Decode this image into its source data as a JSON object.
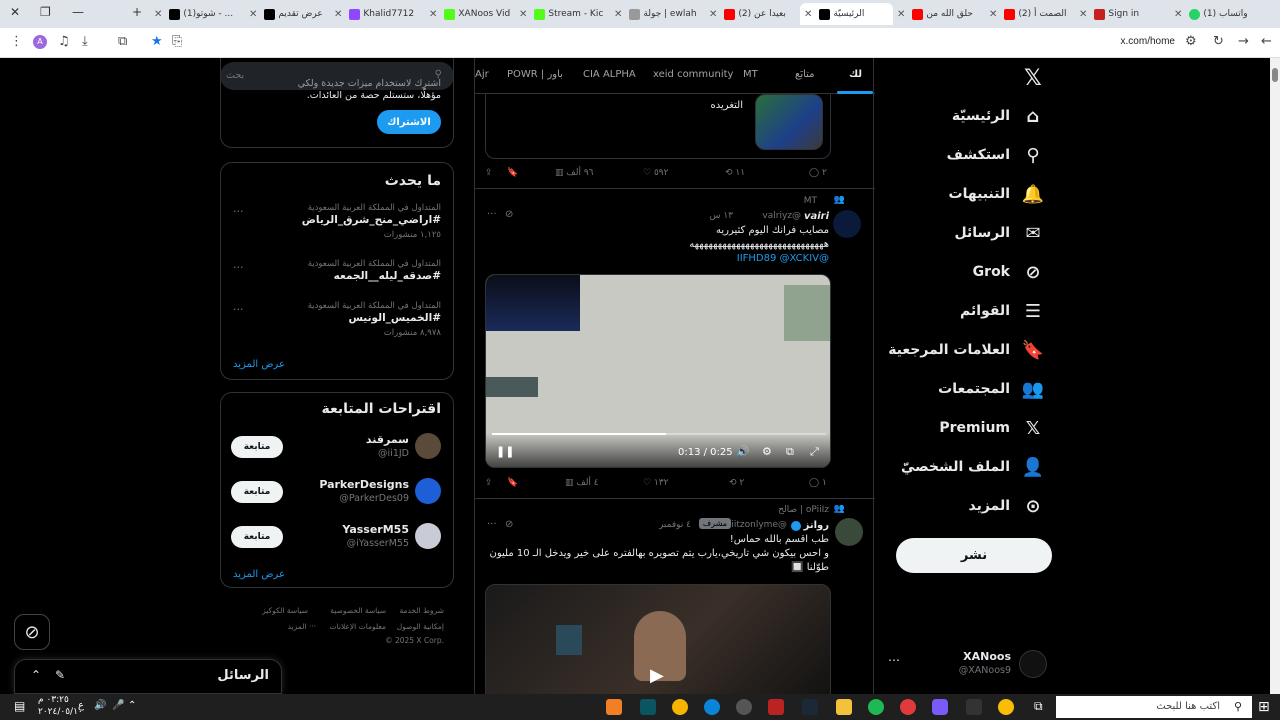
{
  "browser": {
    "tabs": [
      {
        "label": "(1) واتساب",
        "color": "#25d366"
      },
      {
        "label": "Sign in",
        "color": "#c5221f"
      },
      {
        "label": "(2) الصمت أ",
        "color": "#ff0000"
      },
      {
        "label": "حلق الله من",
        "color": "#ff0000"
      },
      {
        "label": "الرئيسيّة",
        "color": "#000000"
      },
      {
        "label": "(2) بعيدا عن",
        "color": "#ff0000"
      },
      {
        "label": "جولة | ewlah",
        "color": "#999999"
      },
      {
        "label": "Stream - Kic",
        "color": "#53fc18"
      },
      {
        "label": "XANoos Vid",
        "color": "#53fc18"
      },
      {
        "label": "Khalid7712",
        "color": "#9146ff"
      },
      {
        "label": "عرض تقديم",
        "color": "#000000"
      },
      {
        "label": "(1)شوتو - ...",
        "color": "#999999"
      }
    ],
    "url": "x.com/home"
  },
  "nav": {
    "items": [
      {
        "label": "الرئيسيّة",
        "icon": "⌂"
      },
      {
        "label": "استكشف",
        "icon": "⚲"
      },
      {
        "label": "التنبيهات",
        "icon": "🔔"
      },
      {
        "label": "الرسائل",
        "icon": "✉"
      },
      {
        "label": "Grok",
        "icon": "⊘"
      },
      {
        "label": "القوائم",
        "icon": "☰"
      },
      {
        "label": "العلامات المرجعية",
        "icon": "🔖"
      },
      {
        "label": "المجتمعات",
        "icon": "👥"
      },
      {
        "label": "Premium",
        "icon": "𝕏"
      },
      {
        "label": "الملف الشخصيّ",
        "icon": "👤"
      },
      {
        "label": "المزيد",
        "icon": "⊙"
      }
    ],
    "post_label": "نشر",
    "profile_name": "XANoos",
    "profile_handle": "@XANoos9",
    "profile_more": "…"
  },
  "timeline": {
    "tabs": [
      "لك",
      "متابَع",
      "MT",
      "xeid community",
      "CIA ALPHA",
      "POWR | باور",
      "Ajr"
    ],
    "tweet0": {
      "text_line2": "التغريده",
      "replies": "٢",
      "retweets": "١١",
      "likes": "٥٩٢",
      "views": "٩٦ ألف"
    },
    "tweet1": {
      "community": "MT",
      "name": "𝙫𝙖𝙞𝙧𝙞",
      "handle": "@valriyz",
      "time": "١٣ س",
      "line1": "مصايب فرانك اليوم كثيرريه",
      "line2": "هههههههههههههههههههههههههههههه",
      "mentions": "@IIFHD89 @XCKIV",
      "video_time": "0:13 / 0:25",
      "replies": "١",
      "retweets": "٢",
      "likes": "١٣٢",
      "views": "٤ ألف"
    },
    "tweet2": {
      "community": "oPiiIz",
      "community_sub": "صالح",
      "name": "روانز",
      "handle": "@iitzonlyme",
      "badge": "مشرف",
      "time": "٤ نوفمبر",
      "line1": "طب اقسم بالله حماس!",
      "line2": "و احس بيكون شي تاريخي،يارب يتم تصويره بهالفتره على خير ويدخل الـ 10 مليون",
      "line3": "طوّلنا 🔲"
    }
  },
  "sidebar": {
    "search_placeholder": "بحث",
    "premium_line1": "اشترك لاستخدام ميزات جديدة ولكي",
    "premium_line2": "مؤهلًا، ستستلم حصة من العائدات.",
    "subscribe_label": "الاشتراك",
    "trends_title": "ما يحدث",
    "trends": [
      {
        "context": "المتداول في المملكة العربية السعودية",
        "name": "#اراضي_منح_شرق_الرياض",
        "count": "١,١٢٥ منشورات"
      },
      {
        "context": "المتداول في المملكة العربية السعودية",
        "name": "#صدقه_ليله__الجمعه",
        "count": ""
      },
      {
        "context": "المتداول في المملكة العربية السعودية",
        "name": "#الخميس_الونيس",
        "count": "٨,٩٧٨ منشورات"
      }
    ],
    "trends_more": "عرض المزيد",
    "suggestions_title": "اقتراحات المتابعة",
    "suggestions": [
      {
        "name": "سمرقند",
        "handle": "@ii1JD",
        "follow": "متابعة",
        "avatar_color": "#5a4a3a"
      },
      {
        "name": "ParkerDesigns",
        "handle": "@ParkerDes09",
        "follow": "متابعة",
        "avatar_color": "#1d5fd6"
      },
      {
        "name": "YasserM55",
        "handle": "@iYasserM55",
        "follow": "متابعة",
        "avatar_color": "#c9ccd6"
      }
    ],
    "suggestions_more": "عرض المزيد",
    "footer": [
      "شروط الخدمة",
      "سياسة الخصوصية",
      "سياسة الكوكيز",
      "إمكانية الوصول",
      "معلومات الإعلانات",
      "··· المزيد",
      "© 2025 X Corp."
    ],
    "messages_title": "الرسائل"
  },
  "taskbar": {
    "search_placeholder": "اكتب هنا للبحث",
    "time": "٠٣:٢٥ م",
    "date": "٢٠٢٤/٠٥/١٠",
    "lang": "ع"
  }
}
